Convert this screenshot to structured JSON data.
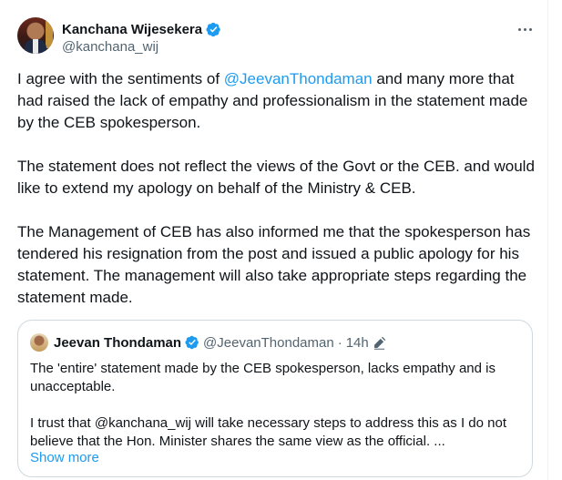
{
  "author": {
    "display_name": "Kanchana Wijesekera",
    "handle": "@kanchana_wij"
  },
  "more_label": "More",
  "tweet": {
    "p1_before": "I agree with the sentiments of ",
    "p1_mention": "@JeevanThondaman",
    "p1_line1_after": " and many more that",
    "p1_line2": "had raised the lack of empathy and professionalism in the statement made",
    "p1_line3": "by the CEB spokesperson.",
    "p2_line1": "The statement does not reflect the views of the Govt or the CEB. and would",
    "p2_line2": "like to extend my apology on behalf of the Ministry & CEB.",
    "p3_line1": "The Management of CEB has also informed me that the spokesperson has",
    "p3_line2": "tendered his resignation from the post and issued a public apology for his",
    "p3_line3": "statement. The management will also take appropriate steps regarding the",
    "p3_line4": "statement made."
  },
  "quote": {
    "display_name": "Jeevan Thondaman",
    "handle": "@JeevanThondaman",
    "separator": "·",
    "time": "14h",
    "p1_line1": "The 'entire' statement made by the CEB spokesperson, lacks empathy and is",
    "p1_line2": "unacceptable.",
    "p2_line1": "I trust that @kanchana_wij will take necessary steps to address this as I do not",
    "p2_line2": "believe that the Hon. Minister shares the same view as the official. ...",
    "show_more": "Show more"
  },
  "icons": {
    "verified": "verified-badge-icon",
    "more": "more-dots-icon",
    "edited": "edit-pencil-icon"
  },
  "colors": {
    "accent": "#1d9bf0",
    "text": "#0f1419",
    "muted": "#536471",
    "border": "#cfd9de"
  }
}
